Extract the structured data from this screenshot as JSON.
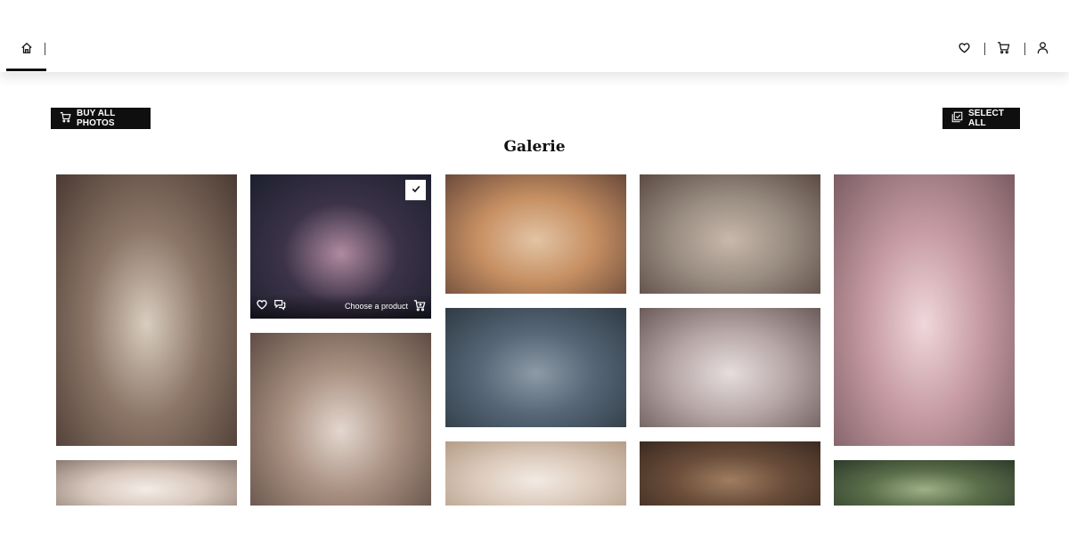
{
  "actions": {
    "buy_all_label": "BUY ALL PHOTOS",
    "select_all_label": "SELECT ALL"
  },
  "gallery": {
    "title": "Galerie",
    "selected_overlay": {
      "choose_label": "Choose a product"
    },
    "photos": [
      {
        "name": "newborn-sleeping-armchair",
        "palette": [
          "#4a3a33",
          "#8c7667",
          "#d8cdbf"
        ]
      },
      {
        "name": "woman-floral-backdrop",
        "palette": [
          "#1c1f2e",
          "#3c3348",
          "#b08aa0"
        ],
        "selected": true
      },
      {
        "name": "baby-in-wooden-tub",
        "palette": [
          "#6b4a3a",
          "#c79063",
          "#e2c4a4"
        ]
      },
      {
        "name": "baby-bathtub-flowers",
        "palette": [
          "#5b4b43",
          "#9a8d82",
          "#c9b8ab"
        ]
      },
      {
        "name": "toddler-pink-van-one",
        "palette": [
          "#7b5d63",
          "#c69aa3",
          "#efd7db"
        ]
      },
      {
        "name": "mother-son-fairy",
        "palette": [
          "#5e4c44",
          "#a88f80",
          "#e3d7cf"
        ]
      },
      {
        "name": "pregnant-woman-sitting",
        "palette": [
          "#2f3b45",
          "#566676",
          "#8d9aa6"
        ]
      },
      {
        "name": "two-girls-cherry-blossom",
        "palette": [
          "#6a5a5a",
          "#b8a8a8",
          "#e6dddd"
        ]
      },
      {
        "name": "baby-flowers-pink",
        "palette": [
          "#8a7a70",
          "#d8c8be",
          "#f3ece6"
        ]
      },
      {
        "name": "baby-butterflies",
        "palette": [
          "#b49c87",
          "#dccbbd",
          "#f2eae3"
        ]
      },
      {
        "name": "baby-flat-cap-wood",
        "palette": [
          "#3b2a20",
          "#6a4d3a",
          "#9f7d60"
        ]
      },
      {
        "name": "garden-greenery",
        "palette": [
          "#2e3a2a",
          "#5a6e4a",
          "#9fb088"
        ]
      }
    ]
  },
  "icons": {
    "home": "home-icon",
    "heart": "heart-icon",
    "cart": "cart-icon",
    "user": "user-icon",
    "select_all": "gallery-select-icon",
    "check": "check-icon",
    "comment": "comment-icon",
    "cart_add": "cart-add-icon"
  }
}
